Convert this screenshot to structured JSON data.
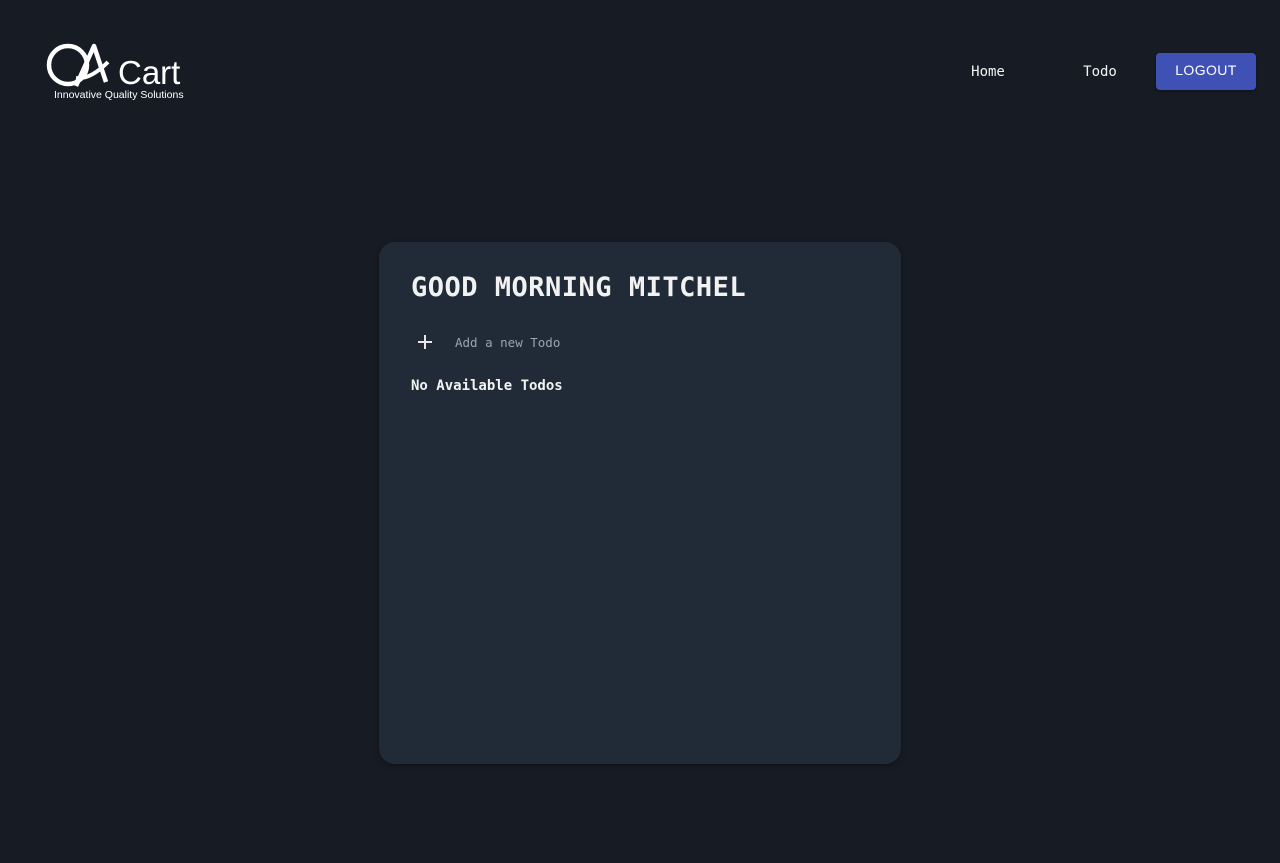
{
  "header": {
    "logo": {
      "brand_mark": "QA",
      "brand_name": "Cart",
      "tagline": "Innovative Quality Solutions"
    },
    "nav": {
      "home_label": "Home",
      "todo_label": "Todo"
    },
    "logout_label": "LOGOUT"
  },
  "main": {
    "greeting": "GOOD MORNING MITCHEL",
    "add_todo": {
      "placeholder": "Add a new Todo",
      "value": "",
      "icon": "plus-icon"
    },
    "empty_message": "No Available Todos"
  },
  "colors": {
    "background": "#171c24",
    "card": "#212b37",
    "accent": "#3f51b5"
  }
}
